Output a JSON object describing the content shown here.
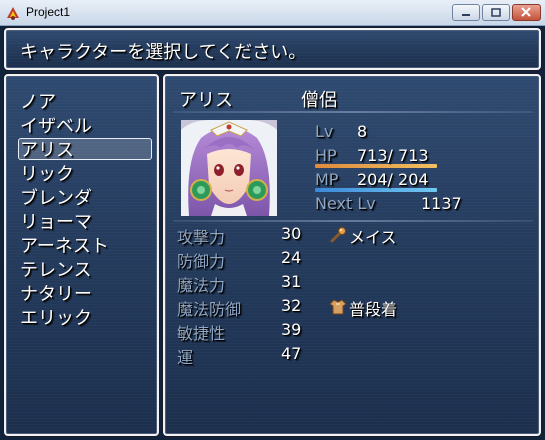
{
  "window": {
    "title": "Project1"
  },
  "help": {
    "text": "キャラクターを選択してください。"
  },
  "menu": {
    "items": [
      "ノア",
      "イザベル",
      "アリス",
      "リック",
      "ブレンダ",
      "リョーマ",
      "アーネスト",
      "テレンス",
      "ナタリー",
      "エリック"
    ],
    "selected_index": 2
  },
  "status": {
    "name": "アリス",
    "class": "僧侶",
    "level_label": "Lv",
    "level": "8",
    "hp_label": "HP",
    "hp_value": "713/ 713",
    "hp_ratio": 1.0,
    "mp_label": "MP",
    "mp_value": "204/ 204",
    "mp_ratio": 1.0,
    "next_label": "Next Lv",
    "next_value": "1137",
    "params": [
      {
        "label": "攻撃力",
        "value": "30"
      },
      {
        "label": "防御力",
        "value": "24"
      },
      {
        "label": "魔法力",
        "value": "31"
      },
      {
        "label": "魔法防御",
        "value": "32"
      },
      {
        "label": "敏捷性",
        "value": "39"
      },
      {
        "label": "運",
        "value": "47"
      }
    ],
    "equipment": [
      {
        "icon": "mace-icon",
        "name": "メイス"
      },
      {
        "icon": "clothing-icon",
        "name": "普段着"
      }
    ]
  },
  "colors": {
    "hp_gauge": [
      "#e08a3c",
      "#f0c060"
    ],
    "mp_gauge": [
      "#3c88d8",
      "#70c8f0"
    ],
    "system_text": "#8fa6c4"
  }
}
